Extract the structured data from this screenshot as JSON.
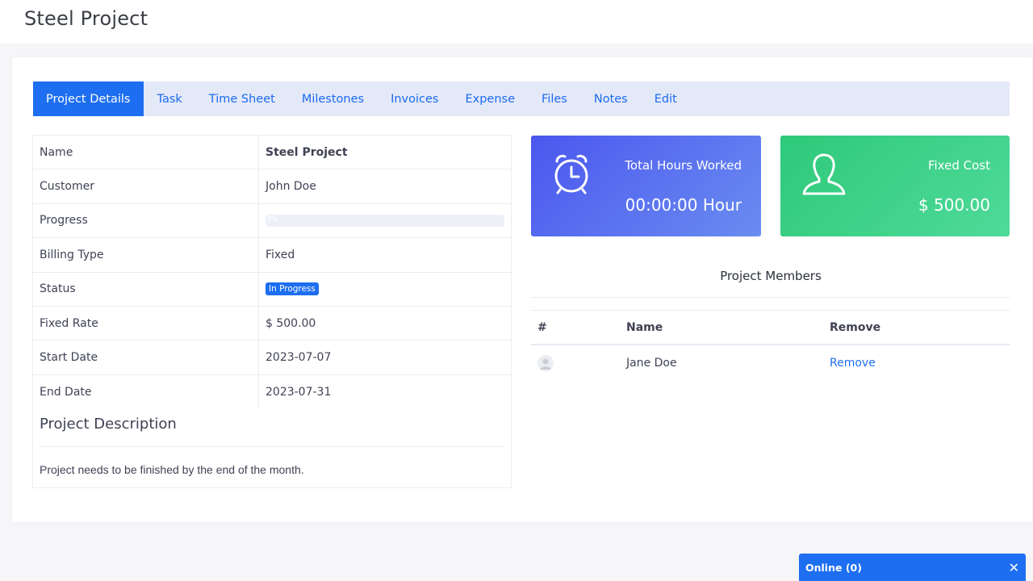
{
  "page": {
    "title": "Steel Project"
  },
  "tabs": [
    {
      "label": "Project Details"
    },
    {
      "label": "Task"
    },
    {
      "label": "Time Sheet"
    },
    {
      "label": "Milestones"
    },
    {
      "label": "Invoices"
    },
    {
      "label": "Expense"
    },
    {
      "label": "Files"
    },
    {
      "label": "Notes"
    },
    {
      "label": "Edit"
    }
  ],
  "details": {
    "rows": [
      {
        "label": "Name",
        "value": "Steel Project"
      },
      {
        "label": "Customer",
        "value": "John Doe"
      },
      {
        "label": "Progress",
        "value": "0%"
      },
      {
        "label": "Billing Type",
        "value": "Fixed"
      },
      {
        "label": "Status",
        "value": "In Progress"
      },
      {
        "label": "Fixed Rate",
        "value": "$ 500.00"
      },
      {
        "label": "Start Date",
        "value": "2023-07-07"
      },
      {
        "label": "End Date",
        "value": "2023-07-31"
      }
    ],
    "progress_fraction": 0,
    "description_title": "Project Description",
    "description": "Project needs to be finished by the end of the month."
  },
  "stats": {
    "hours": {
      "label": "Total Hours Worked",
      "value": "00:00:00 Hour",
      "icon": "alarm-clock-icon"
    },
    "cost": {
      "label": "Fixed Cost",
      "value": "$ 500.00",
      "icon": "user-icon"
    }
  },
  "members": {
    "title": "Project Members",
    "headers": {
      "index": "#",
      "name": "Name",
      "remove": "Remove"
    },
    "rows": [
      {
        "name": "Jane Doe",
        "action": "Remove"
      }
    ]
  },
  "chat": {
    "label": "Online (0)",
    "close": "✕"
  },
  "colors": {
    "primary": "#1d6ef0",
    "tab_bg": "#e4e9f7",
    "hours_card": "#4b57ef",
    "cost_card": "#2ec97a"
  }
}
